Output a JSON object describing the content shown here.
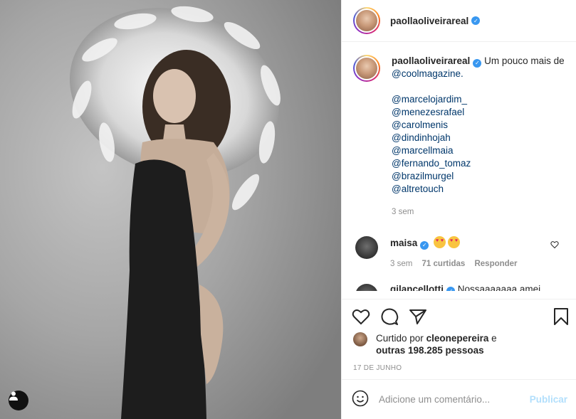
{
  "post": {
    "author": "paollaoliveirareal",
    "caption_text": "Um pouco mais de",
    "caption_mention": "@coolmagazine.",
    "mentions": [
      "@marcelojardim_",
      "@menezesrafael",
      "@carolmenis",
      "@dindinhojah",
      "@marcellmaia",
      "@fernando_tomaz",
      "@brazilmurgel",
      "@altretouch"
    ],
    "caption_time": "3 sem"
  },
  "comments": [
    {
      "user": "maisa",
      "time": "3 sem",
      "likes": "71 curtidas",
      "reply": "Responder"
    },
    {
      "user": "gilancellotti",
      "text": "Nossaaaaaaa amei"
    }
  ],
  "likes": {
    "prefix": "Curtido por",
    "user": "cleonepereira",
    "suffix": "e",
    "others": "outras 198.285 pessoas"
  },
  "date": "17 DE JUNHO",
  "add_comment": {
    "placeholder": "Adicione um comentário...",
    "publish_label": "Publicar"
  },
  "icons": [
    "user-tag-icon",
    "verified-icon",
    "heart-icon",
    "comment-icon",
    "share-icon",
    "save-icon",
    "emoji-icon"
  ],
  "colors": {
    "verified": "#3897f0",
    "link": "#00376b",
    "muted": "#8e8e8e",
    "publish_disabled": "#b2dffc"
  }
}
